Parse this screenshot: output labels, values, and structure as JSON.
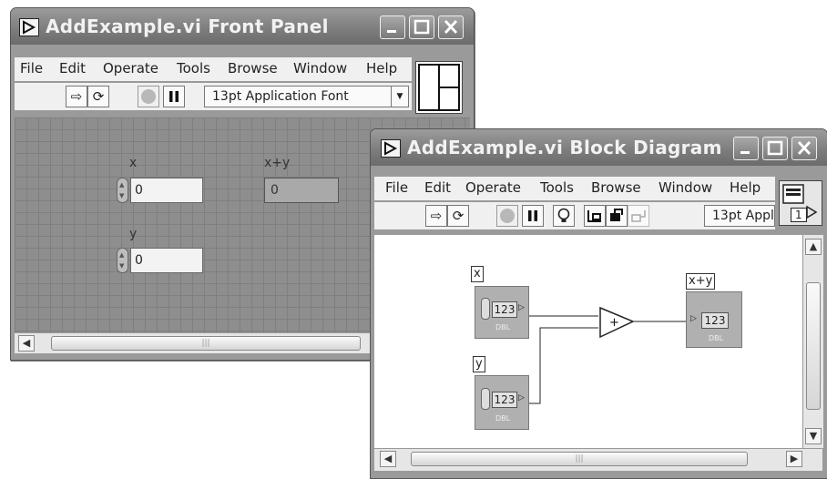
{
  "front_panel": {
    "title": "AddExample.vi Front Panel",
    "menu": [
      "File",
      "Edit",
      "Operate",
      "Tools",
      "Browse",
      "Window",
      "Help"
    ],
    "font": "13pt Application Font",
    "controls": {
      "x_label": "x",
      "x_value": "0",
      "y_label": "y",
      "y_value": "0",
      "sum_label": "x+y",
      "sum_value": "0"
    }
  },
  "block_diagram": {
    "title": "AddExample.vi Block Diagram",
    "menu": [
      "File",
      "Edit",
      "Operate",
      "Tools",
      "Browse",
      "Window",
      "Help"
    ],
    "font": "13pt Appl",
    "connector_number": "1",
    "terminals": {
      "x_label": "x",
      "x_type": "123",
      "x_sub": "DBL",
      "y_label": "y",
      "y_type": "123",
      "y_sub": "DBL",
      "sum_label": "x+y",
      "sum_type": "123",
      "sum_sub": "DBL"
    },
    "add_symbol": "+"
  }
}
